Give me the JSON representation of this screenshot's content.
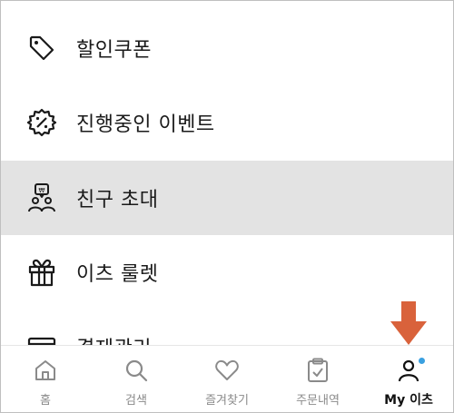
{
  "menu": {
    "items": [
      {
        "label": "할인쿠폰",
        "icon": "tag-icon"
      },
      {
        "label": "진행중인 이벤트",
        "icon": "percent-badge-icon"
      },
      {
        "label": "친구 초대",
        "icon": "invite-friends-icon"
      },
      {
        "label": "이츠 룰렛",
        "icon": "gift-icon"
      },
      {
        "label": "결제관리",
        "icon": "card-icon"
      }
    ],
    "active_index": 2
  },
  "tabbar": {
    "tabs": [
      {
        "label": "홈",
        "icon": "home-icon"
      },
      {
        "label": "검색",
        "icon": "search-icon"
      },
      {
        "label": "즐겨찾기",
        "icon": "heart-icon"
      },
      {
        "label": "주문내역",
        "icon": "clipboard-check-icon"
      },
      {
        "label": "My 이츠",
        "icon": "person-icon"
      }
    ],
    "active_index": 4
  },
  "colors": {
    "arrow": "#d9623b",
    "notification_dot": "#3aa0e0",
    "active_row_bg": "#e3e3e3"
  }
}
